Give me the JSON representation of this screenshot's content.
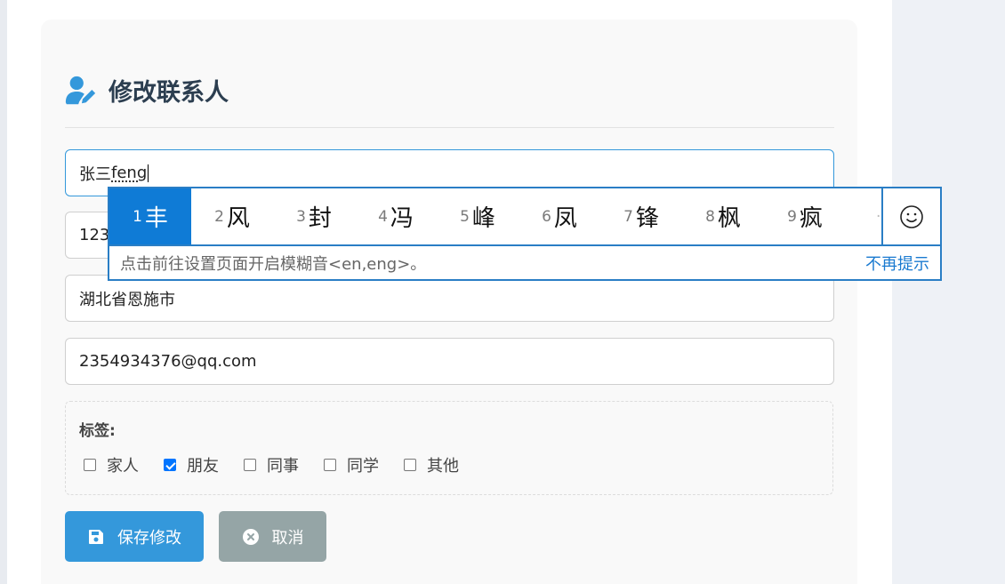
{
  "form": {
    "title": "修改联系人",
    "name_value": "张三",
    "name_preedit": "feng",
    "phone_value": "123",
    "address_value": "湖北省恩施市",
    "email_value": "2354934376@qq.com",
    "tags_label": "标签:",
    "tags": [
      {
        "label": "家人",
        "checked": false
      },
      {
        "label": "朋友",
        "checked": true
      },
      {
        "label": "同事",
        "checked": false
      },
      {
        "label": "同学",
        "checked": false
      },
      {
        "label": "其他",
        "checked": false
      }
    ],
    "save_label": "保存修改",
    "cancel_label": "取消"
  },
  "ime": {
    "candidates": [
      {
        "num": "1",
        "char": "丰"
      },
      {
        "num": "2",
        "char": "风"
      },
      {
        "num": "3",
        "char": "封"
      },
      {
        "num": "4",
        "char": "冯"
      },
      {
        "num": "5",
        "char": "峰"
      },
      {
        "num": "6",
        "char": "凤"
      },
      {
        "num": "7",
        "char": "锋"
      },
      {
        "num": "8",
        "char": "枫"
      },
      {
        "num": "9",
        "char": "疯"
      }
    ],
    "hint": "点击前往设置页面开启模糊音<en,eng>。",
    "no_remind": "不再提示",
    "emoji_icon": "smiley-icon"
  },
  "colors": {
    "accent": "#3498db",
    "cancel": "#95a5a6",
    "ime_active": "#0f7bd6",
    "ime_border": "#2a7ec5"
  }
}
